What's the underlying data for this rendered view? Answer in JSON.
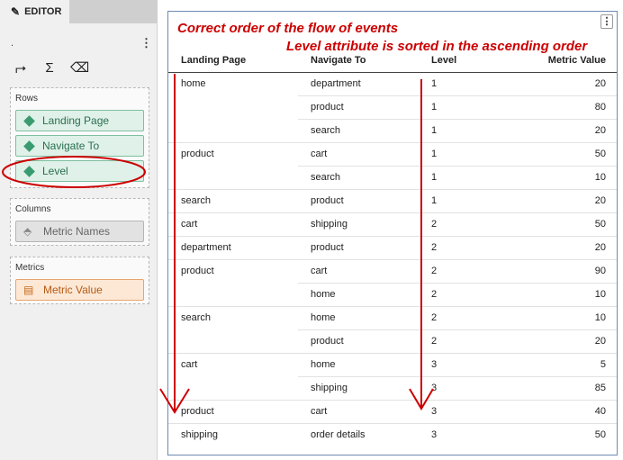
{
  "editor": {
    "tab_label": "EDITOR",
    "dot": ".",
    "kebab": "⋮",
    "toolbar": {
      "swap": "⮣",
      "sum": "Σ",
      "eraser": "⌫"
    },
    "rows_title": "Rows",
    "rows": [
      "Landing Page",
      "Navigate To",
      "Level"
    ],
    "columns_title": "Columns",
    "columns": [
      "Metric Names"
    ],
    "metrics_title": "Metrics",
    "metrics": [
      "Metric Value"
    ]
  },
  "annotations": {
    "line1": "Correct order of the flow of events",
    "line2": "Level attribute is sorted in the ascending order",
    "arrow_color": "#cc0000"
  },
  "grid": {
    "kebab": "⋮",
    "headers": [
      "Landing Page",
      "Navigate To",
      "Level",
      "Metric Value"
    ],
    "rows": [
      {
        "landing": "home",
        "navigate": "department",
        "level": "1",
        "value": "20"
      },
      {
        "landing": "",
        "navigate": "product",
        "level": "1",
        "value": "80"
      },
      {
        "landing": "",
        "navigate": "search",
        "level": "1",
        "value": "20"
      },
      {
        "landing": "product",
        "navigate": "cart",
        "level": "1",
        "value": "50"
      },
      {
        "landing": "",
        "navigate": "search",
        "level": "1",
        "value": "10"
      },
      {
        "landing": "search",
        "navigate": "product",
        "level": "1",
        "value": "20"
      },
      {
        "landing": "cart",
        "navigate": "shipping",
        "level": "2",
        "value": "50"
      },
      {
        "landing": "department",
        "navigate": "product",
        "level": "2",
        "value": "20"
      },
      {
        "landing": "product",
        "navigate": "cart",
        "level": "2",
        "value": "90"
      },
      {
        "landing": "",
        "navigate": "home",
        "level": "2",
        "value": "10"
      },
      {
        "landing": "search",
        "navigate": "home",
        "level": "2",
        "value": "10"
      },
      {
        "landing": "",
        "navigate": "product",
        "level": "2",
        "value": "20"
      },
      {
        "landing": "cart",
        "navigate": "home",
        "level": "3",
        "value": "5"
      },
      {
        "landing": "",
        "navigate": "shipping",
        "level": "3",
        "value": "85"
      },
      {
        "landing": "product",
        "navigate": "cart",
        "level": "3",
        "value": "40"
      },
      {
        "landing": "shipping",
        "navigate": "order details",
        "level": "3",
        "value": "50"
      }
    ]
  }
}
